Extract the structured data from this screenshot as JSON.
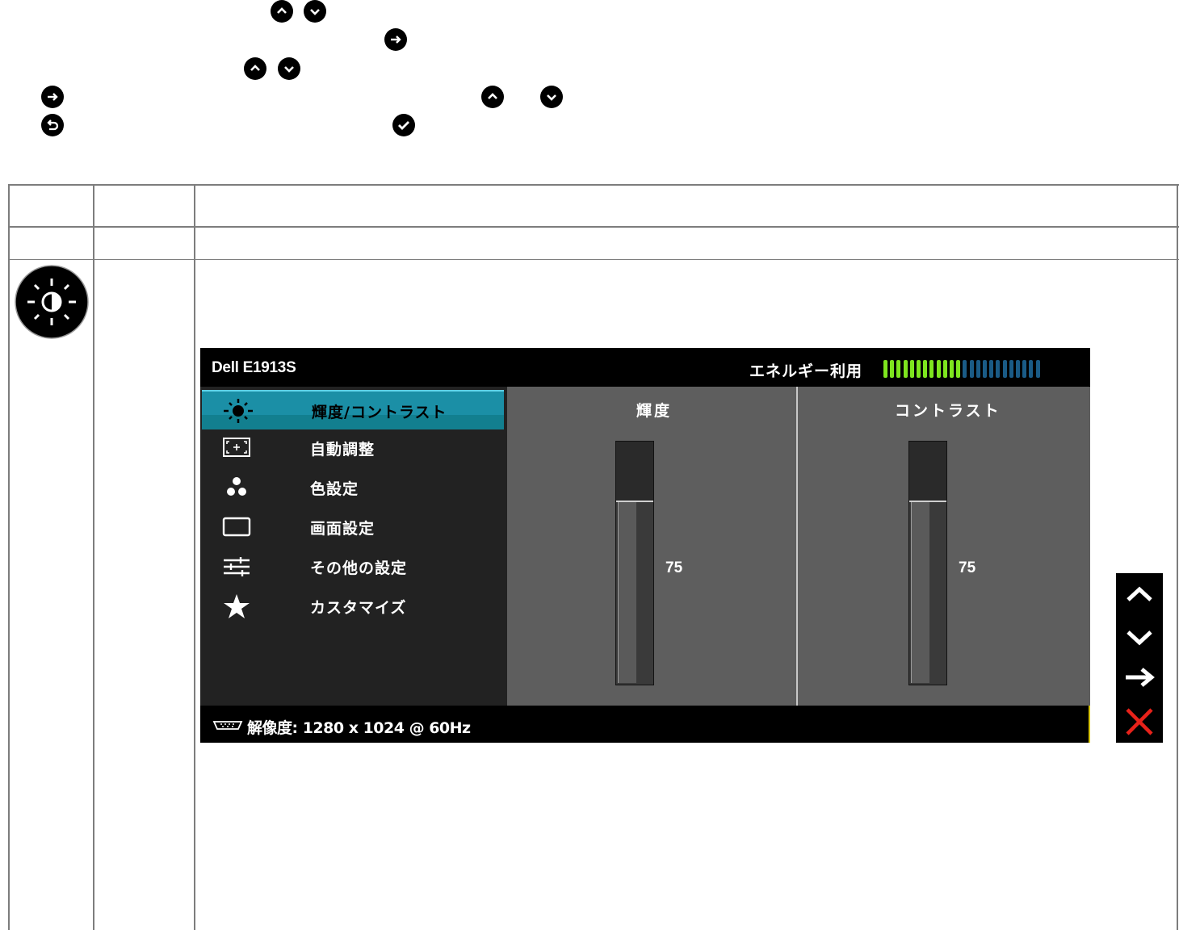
{
  "osd": {
    "model": "Dell E1913S",
    "energy_label": "エネルギー利用",
    "energy_level": 0.5,
    "colors": {
      "menu_selected": "#1b8fa6",
      "energy_on": "#7ee51e",
      "energy_off": "#1a5b86",
      "panel_bg": "#5e5e5e"
    },
    "menu_items": [
      {
        "label": "輝度/コントラスト",
        "icon": "brightness-contrast-icon",
        "selected": true
      },
      {
        "label": "自動調整",
        "icon": "auto-adjust-icon",
        "selected": false
      },
      {
        "label": "色設定",
        "icon": "color-settings-icon",
        "selected": false
      },
      {
        "label": "画面設定",
        "icon": "display-settings-icon",
        "selected": false
      },
      {
        "label": "その他の設定",
        "icon": "other-settings-icon",
        "selected": false
      },
      {
        "label": "カスタマイズ",
        "icon": "customize-star-icon",
        "selected": false
      }
    ],
    "brightness": {
      "label": "輝度",
      "value": "75"
    },
    "contrast": {
      "label": "コントラスト",
      "value": "75"
    },
    "resolution": "解像度: 1280 x 1024 @ 60Hz"
  },
  "nav_buttons": [
    "up-icon",
    "down-icon",
    "enter-arrow-icon",
    "exit-x-icon"
  ]
}
